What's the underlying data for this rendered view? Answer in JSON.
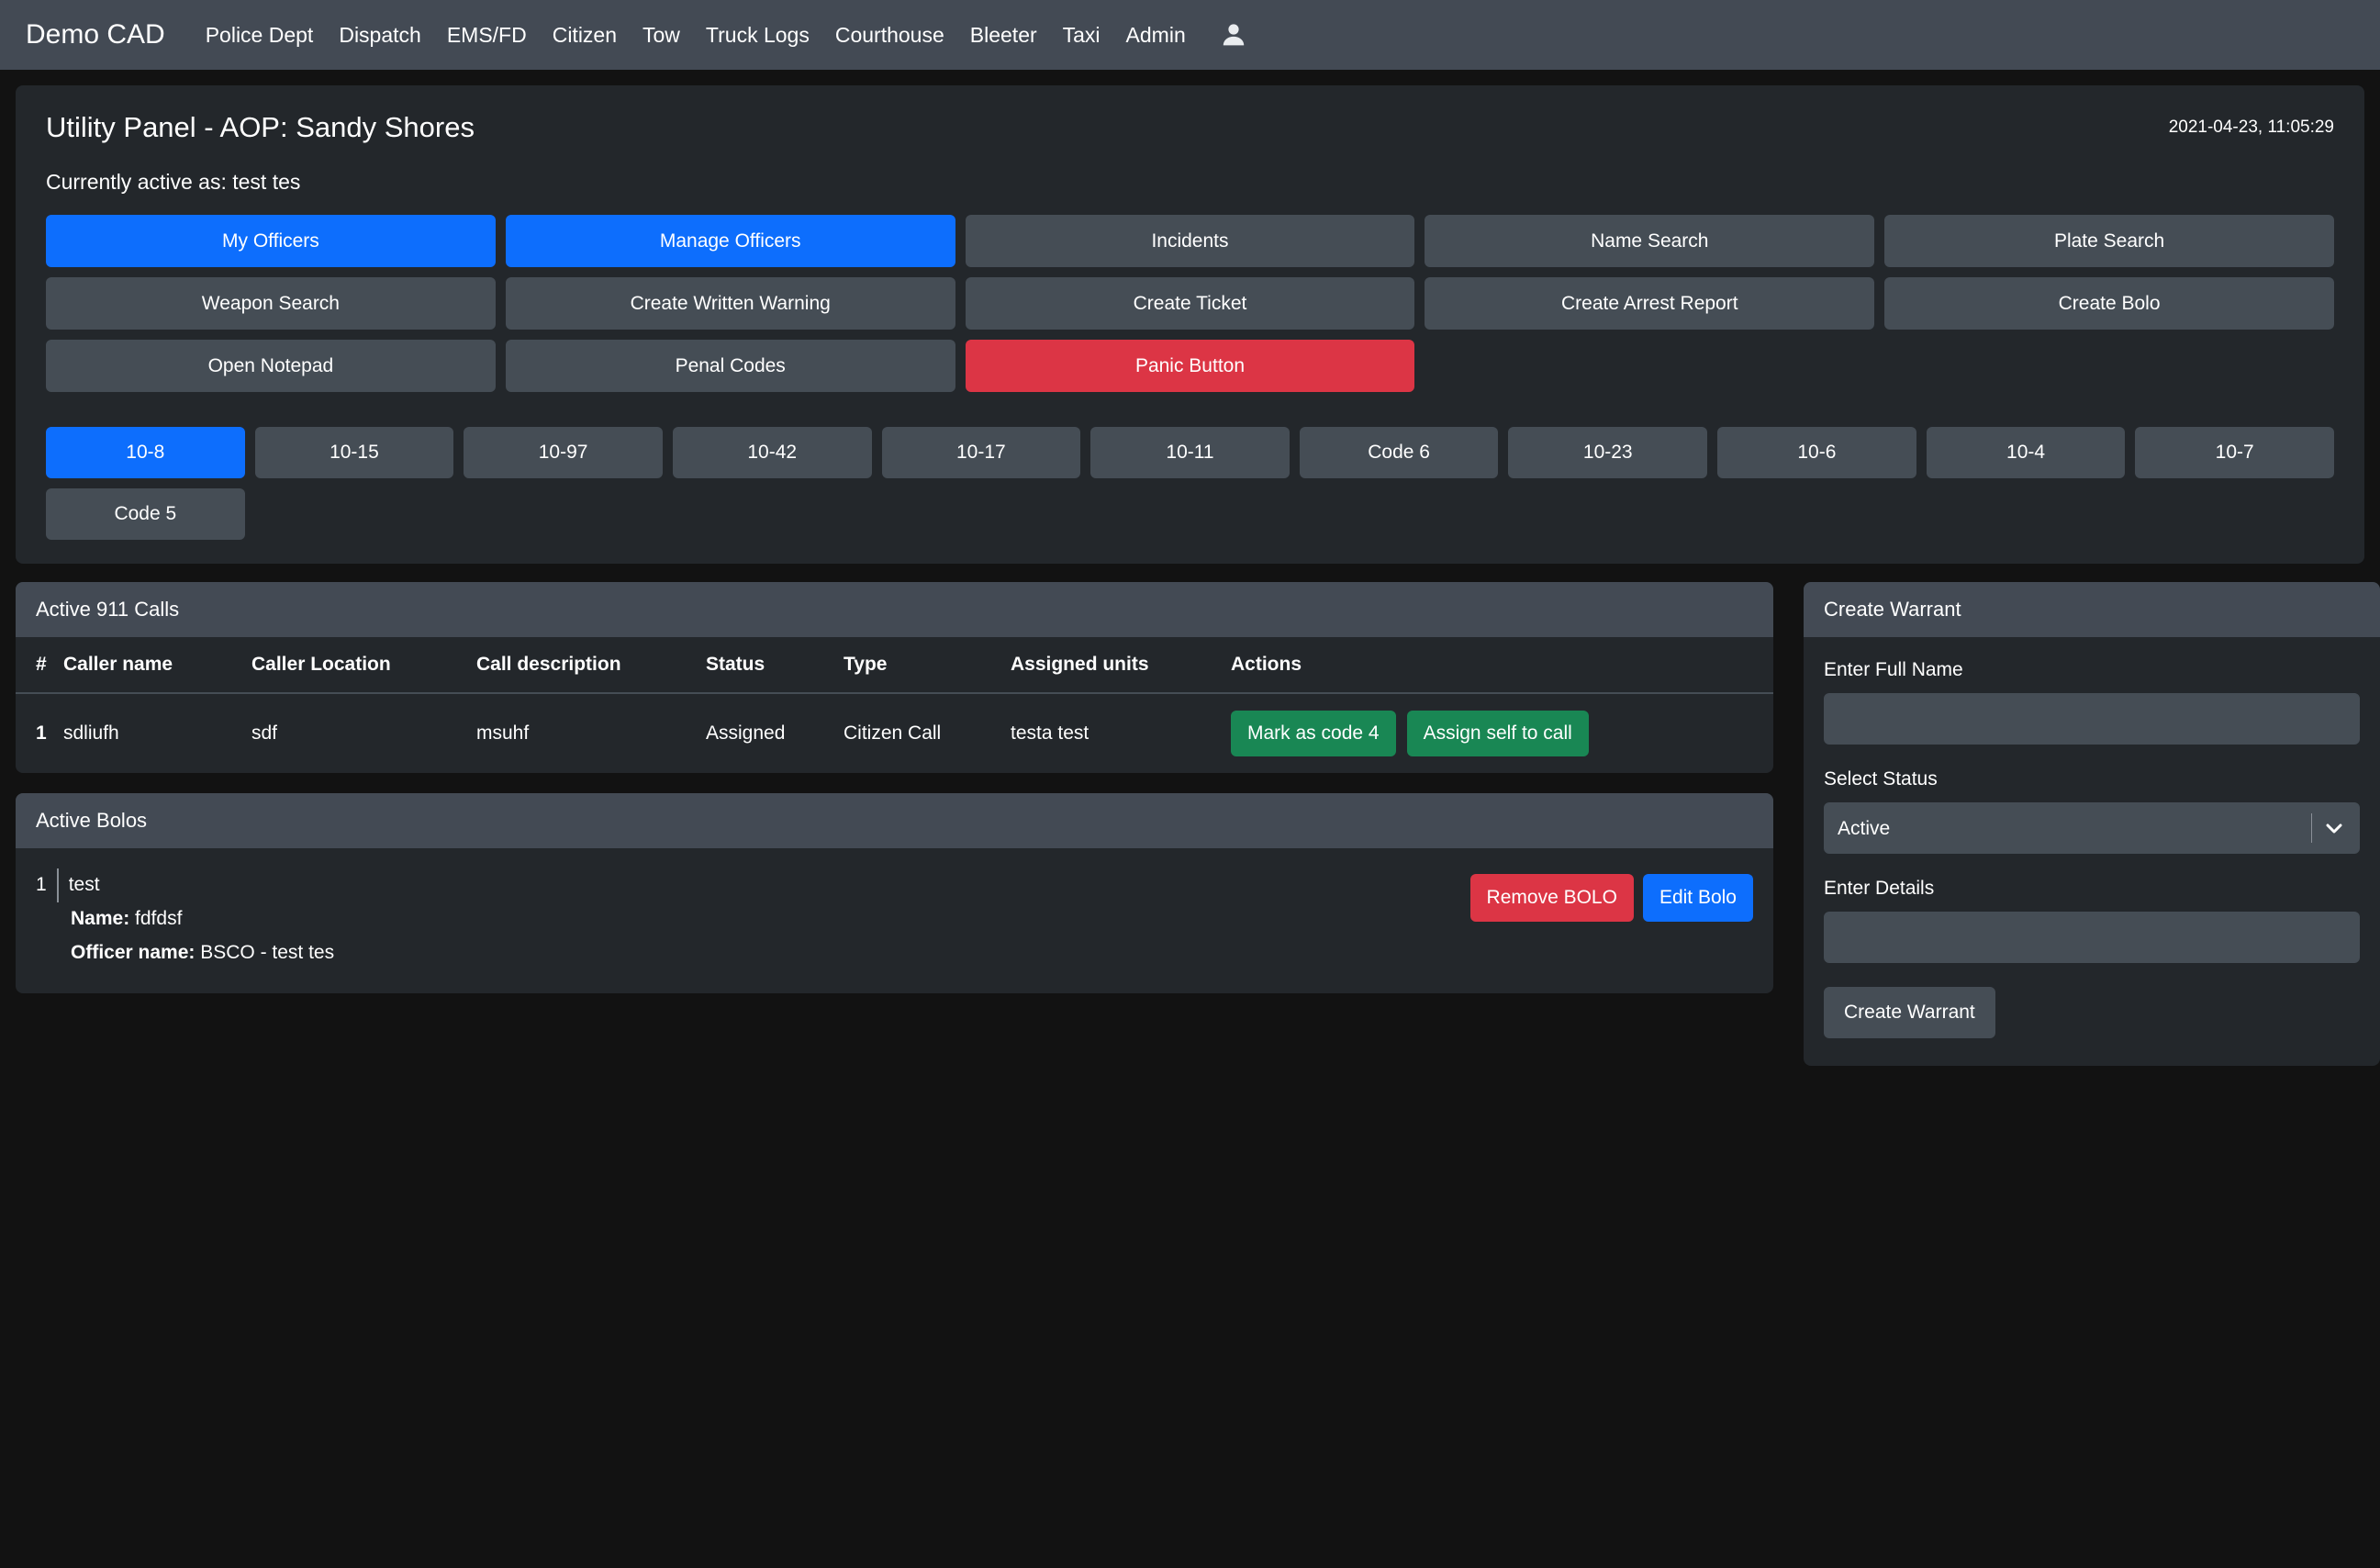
{
  "navbar": {
    "brand": "Demo CAD",
    "links": [
      {
        "label": "Police Dept"
      },
      {
        "label": "Dispatch"
      },
      {
        "label": "EMS/FD"
      },
      {
        "label": "Citizen"
      },
      {
        "label": "Tow"
      },
      {
        "label": "Truck Logs"
      },
      {
        "label": "Courthouse"
      },
      {
        "label": "Bleeter"
      },
      {
        "label": "Taxi"
      },
      {
        "label": "Admin"
      }
    ],
    "user_icon": "user-icon"
  },
  "panel": {
    "title": "Utility Panel - AOP: Sandy Shores",
    "timestamp": "2021-04-23, 11:05:29",
    "active_as": "Currently active as: test tes"
  },
  "actions": [
    {
      "label": "My Officers",
      "variant": "primary"
    },
    {
      "label": "Manage Officers",
      "variant": "primary"
    },
    {
      "label": "Incidents",
      "variant": "secondary"
    },
    {
      "label": "Name Search",
      "variant": "secondary"
    },
    {
      "label": "Plate Search",
      "variant": "secondary"
    },
    {
      "label": "Weapon Search",
      "variant": "secondary"
    },
    {
      "label": "Create Written Warning",
      "variant": "secondary"
    },
    {
      "label": "Create Ticket",
      "variant": "secondary"
    },
    {
      "label": "Create Arrest Report",
      "variant": "secondary"
    },
    {
      "label": "Create Bolo",
      "variant": "secondary"
    },
    {
      "label": "Open Notepad",
      "variant": "secondary"
    },
    {
      "label": "Penal Codes",
      "variant": "secondary"
    },
    {
      "label": "Panic Button",
      "variant": "danger"
    }
  ],
  "statuses": [
    {
      "label": "10-8",
      "active": true
    },
    {
      "label": "10-15",
      "active": false
    },
    {
      "label": "10-97",
      "active": false
    },
    {
      "label": "10-42",
      "active": false
    },
    {
      "label": "10-17",
      "active": false
    },
    {
      "label": "10-11",
      "active": false
    },
    {
      "label": "Code 6",
      "active": false
    },
    {
      "label": "10-23",
      "active": false
    },
    {
      "label": "10-6",
      "active": false
    },
    {
      "label": "10-4",
      "active": false
    },
    {
      "label": "10-7",
      "active": false
    },
    {
      "label": "Code 5",
      "active": false
    }
  ],
  "calls": {
    "title": "Active 911 Calls",
    "columns": [
      "#",
      "Caller name",
      "Caller Location",
      "Call description",
      "Status",
      "Type",
      "Assigned units",
      "Actions"
    ],
    "rows": [
      {
        "num": "1",
        "caller_name": "sdliufh",
        "caller_location": "sdf",
        "call_description": "msuhf",
        "status": "Assigned",
        "type": "Citizen Call",
        "assigned_units": "testa test",
        "action_code4": "Mark as code 4",
        "action_assign": "Assign self to call"
      }
    ]
  },
  "bolos": {
    "title": "Active Bolos",
    "items": [
      {
        "index": "1",
        "description": "test",
        "name_label": "Name:",
        "name_value": "fdfdsf",
        "officer_label": "Officer name:",
        "officer_value": "BSCO - test tes",
        "remove_label": "Remove BOLO",
        "edit_label": "Edit Bolo"
      }
    ]
  },
  "warrant": {
    "title": "Create Warrant",
    "name_label": "Enter Full Name",
    "name_value": "",
    "name_placeholder": "",
    "status_label": "Select Status",
    "status_value": "Active",
    "status_options": [
      "Active"
    ],
    "details_label": "Enter Details",
    "details_value": "",
    "details_placeholder": "",
    "submit_label": "Create Warrant"
  },
  "colors": {
    "primary": "#0d6efd",
    "danger": "#dc3545",
    "success": "#198754",
    "secondary": "#454d55",
    "navbar": "#434a54",
    "panel": "#23272b",
    "page": "#121212"
  }
}
